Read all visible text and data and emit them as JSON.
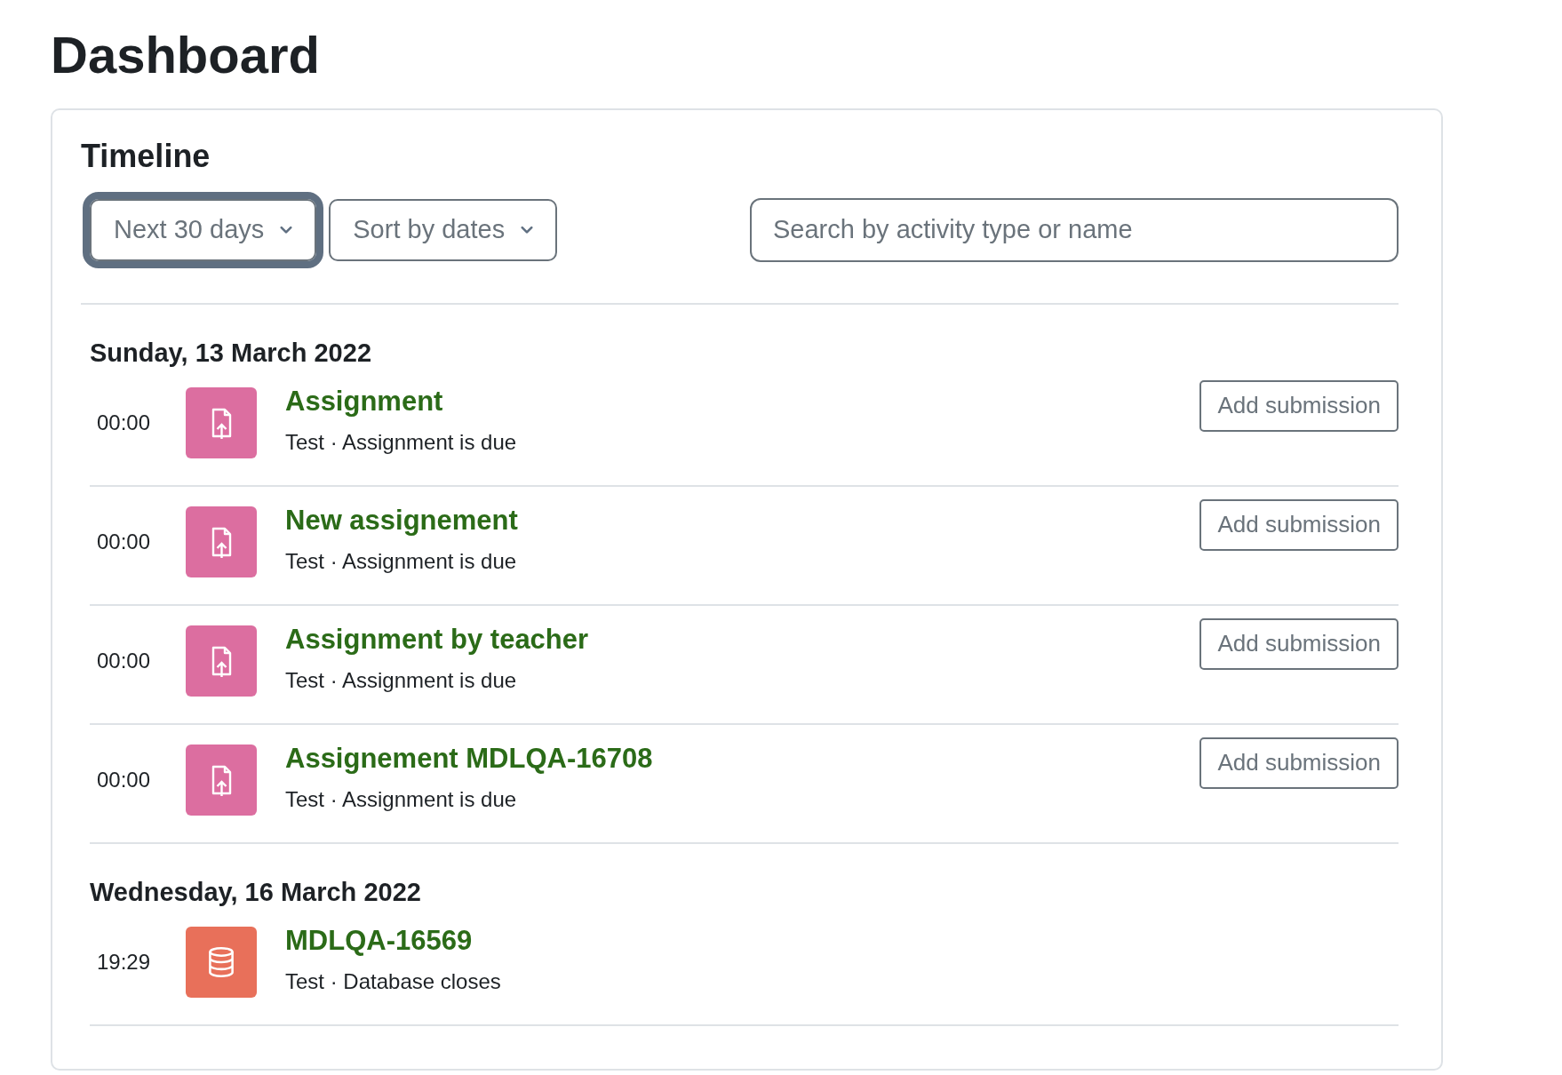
{
  "page_title": "Dashboard",
  "timeline": {
    "title": "Timeline",
    "filters": [
      {
        "label": "Next 30 days",
        "focused": true
      },
      {
        "label": "Sort by dates",
        "focused": false
      }
    ],
    "search": {
      "placeholder": "Search by activity type or name"
    },
    "days": [
      {
        "date": "Sunday, 13 March 2022",
        "events": [
          {
            "time": "00:00",
            "kind": "assignment",
            "name": "Assignment",
            "detail": "Test · Assignment is due",
            "action": "Add submission"
          },
          {
            "time": "00:00",
            "kind": "assignment",
            "name": "New assignement",
            "detail": "Test · Assignment is due",
            "action": "Add submission"
          },
          {
            "time": "00:00",
            "kind": "assignment",
            "name": "Assignment by teacher",
            "detail": "Test · Assignment is due",
            "action": "Add submission"
          },
          {
            "time": "00:00",
            "kind": "assignment",
            "name": "Assignement MDLQA-16708",
            "detail": "Test · Assignment is due",
            "action": "Add submission"
          }
        ]
      },
      {
        "date": "Wednesday, 16 March 2022",
        "events": [
          {
            "time": "19:29",
            "kind": "database",
            "name": "MDLQA-16569",
            "detail": "Test · Database closes"
          }
        ]
      }
    ]
  }
}
